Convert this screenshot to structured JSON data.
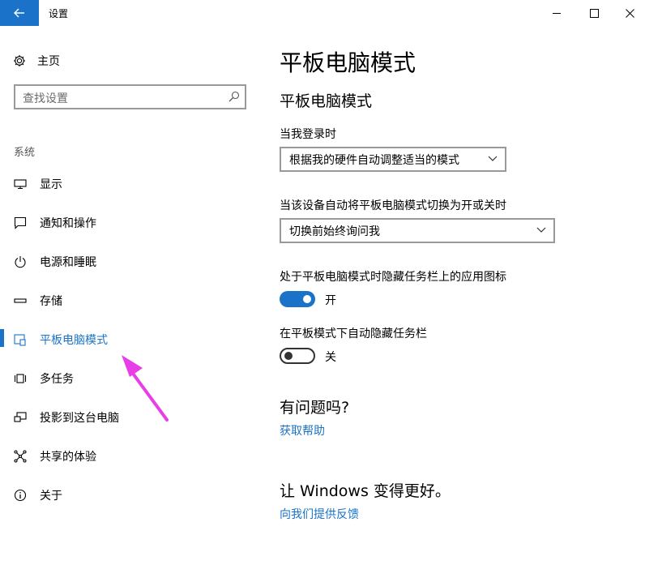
{
  "window": {
    "title": "设置",
    "accent": "#1a73c9"
  },
  "sidebar": {
    "home_label": "主页",
    "search_placeholder": "查找设置",
    "section_label": "系统",
    "items": [
      {
        "label": "显示",
        "icon": "monitor-icon"
      },
      {
        "label": "通知和操作",
        "icon": "notification-icon"
      },
      {
        "label": "电源和睡眠",
        "icon": "power-icon"
      },
      {
        "label": "存储",
        "icon": "storage-icon"
      },
      {
        "label": "平板电脑模式",
        "icon": "tablet-mode-icon",
        "active": true
      },
      {
        "label": "多任务",
        "icon": "multitask-icon"
      },
      {
        "label": "投影到这台电脑",
        "icon": "project-icon"
      },
      {
        "label": "共享的体验",
        "icon": "share-icon"
      },
      {
        "label": "关于",
        "icon": "info-icon"
      }
    ]
  },
  "main": {
    "page_title": "平板电脑模式",
    "section_title": "平板电脑模式",
    "signin_label": "当我登录时",
    "signin_value": "根据我的硬件自动调整适当的模式",
    "switch_label": "当该设备自动将平板电脑模式切换为开或关时",
    "switch_value": "切换前始终询问我",
    "hide_icons_label": "处于平板电脑模式时隐藏任务栏上的应用图标",
    "hide_icons_state": "开",
    "hide_taskbar_label": "在平板模式下自动隐藏任务栏",
    "hide_taskbar_state": "关",
    "question_title": "有问题吗?",
    "help_link": "获取帮助",
    "better_title": "让 Windows 变得更好。",
    "feedback_link": "向我们提供反馈"
  },
  "annotation": {
    "arrow_color": "#e83ee8"
  }
}
